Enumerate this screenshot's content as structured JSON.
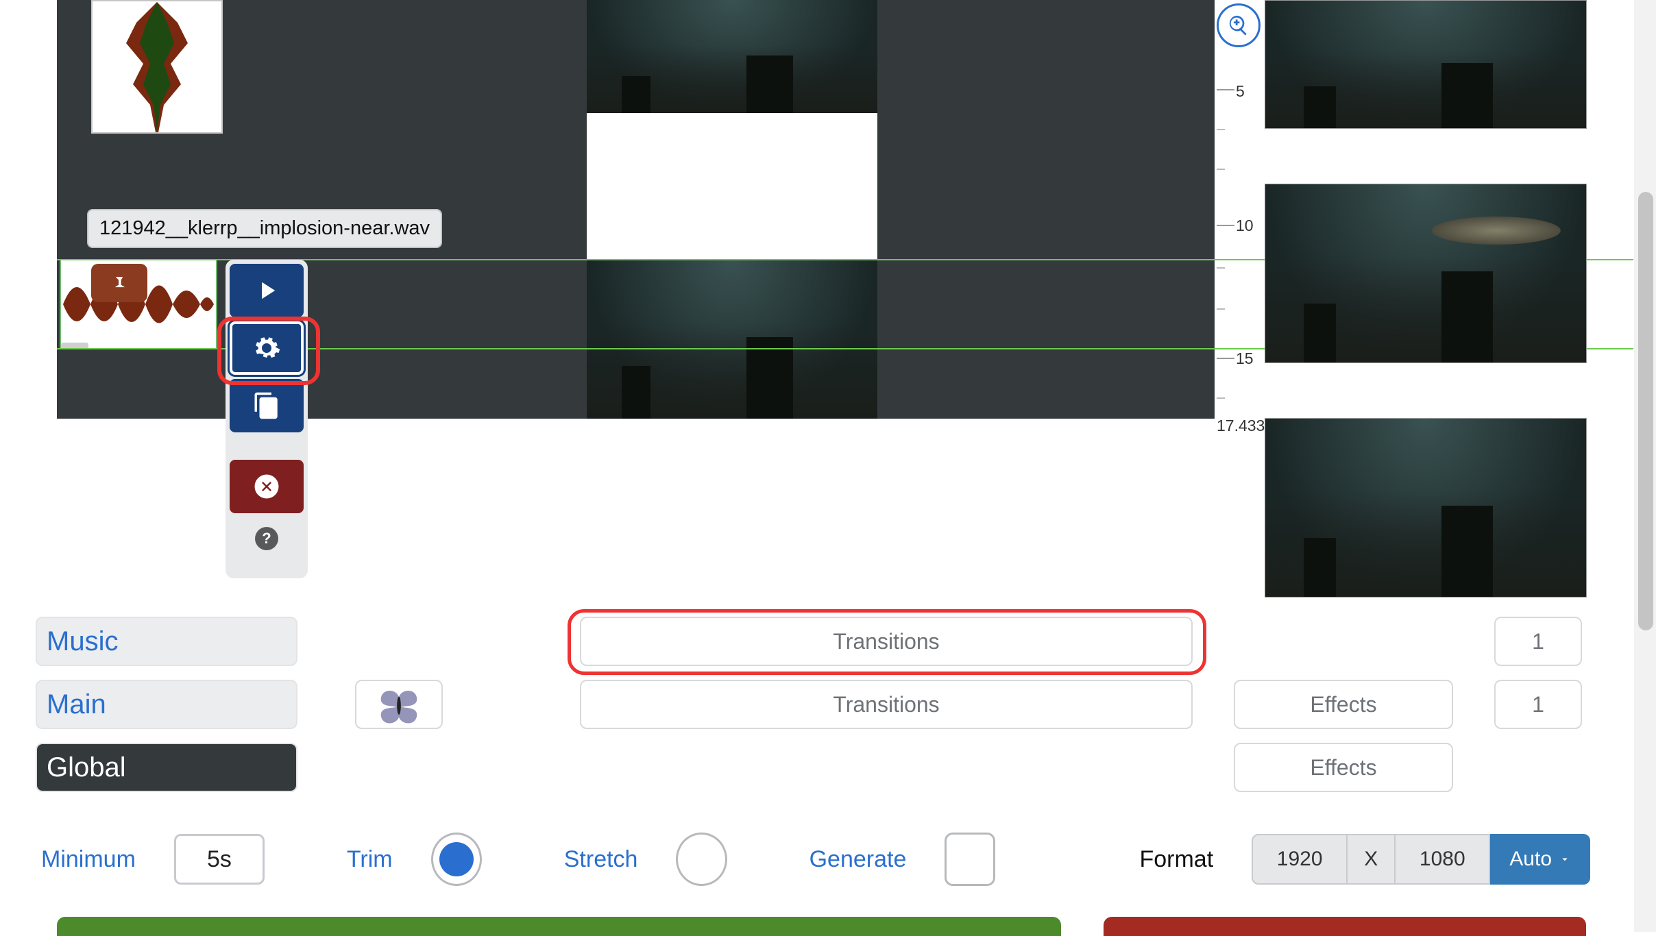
{
  "clip": {
    "filename": "121942__klerrp__implosion-near.wav"
  },
  "ruler": {
    "ticks": [
      "5",
      "10",
      "15",
      "17.433"
    ]
  },
  "tracks": {
    "music_label": "Music",
    "main_label": "Main",
    "global_label": "Global",
    "transitions_label": "Transitions",
    "effects_label": "Effects",
    "count_1": "1"
  },
  "options": {
    "minimum_label": "Minimum",
    "minimum_value": "5s",
    "trim_label": "Trim",
    "stretch_label": "Stretch",
    "generate_label": "Generate",
    "format_label": "Format",
    "width": "1920",
    "x_label": "X",
    "height": "1080",
    "auto_label": "Auto"
  },
  "help_label": "?"
}
